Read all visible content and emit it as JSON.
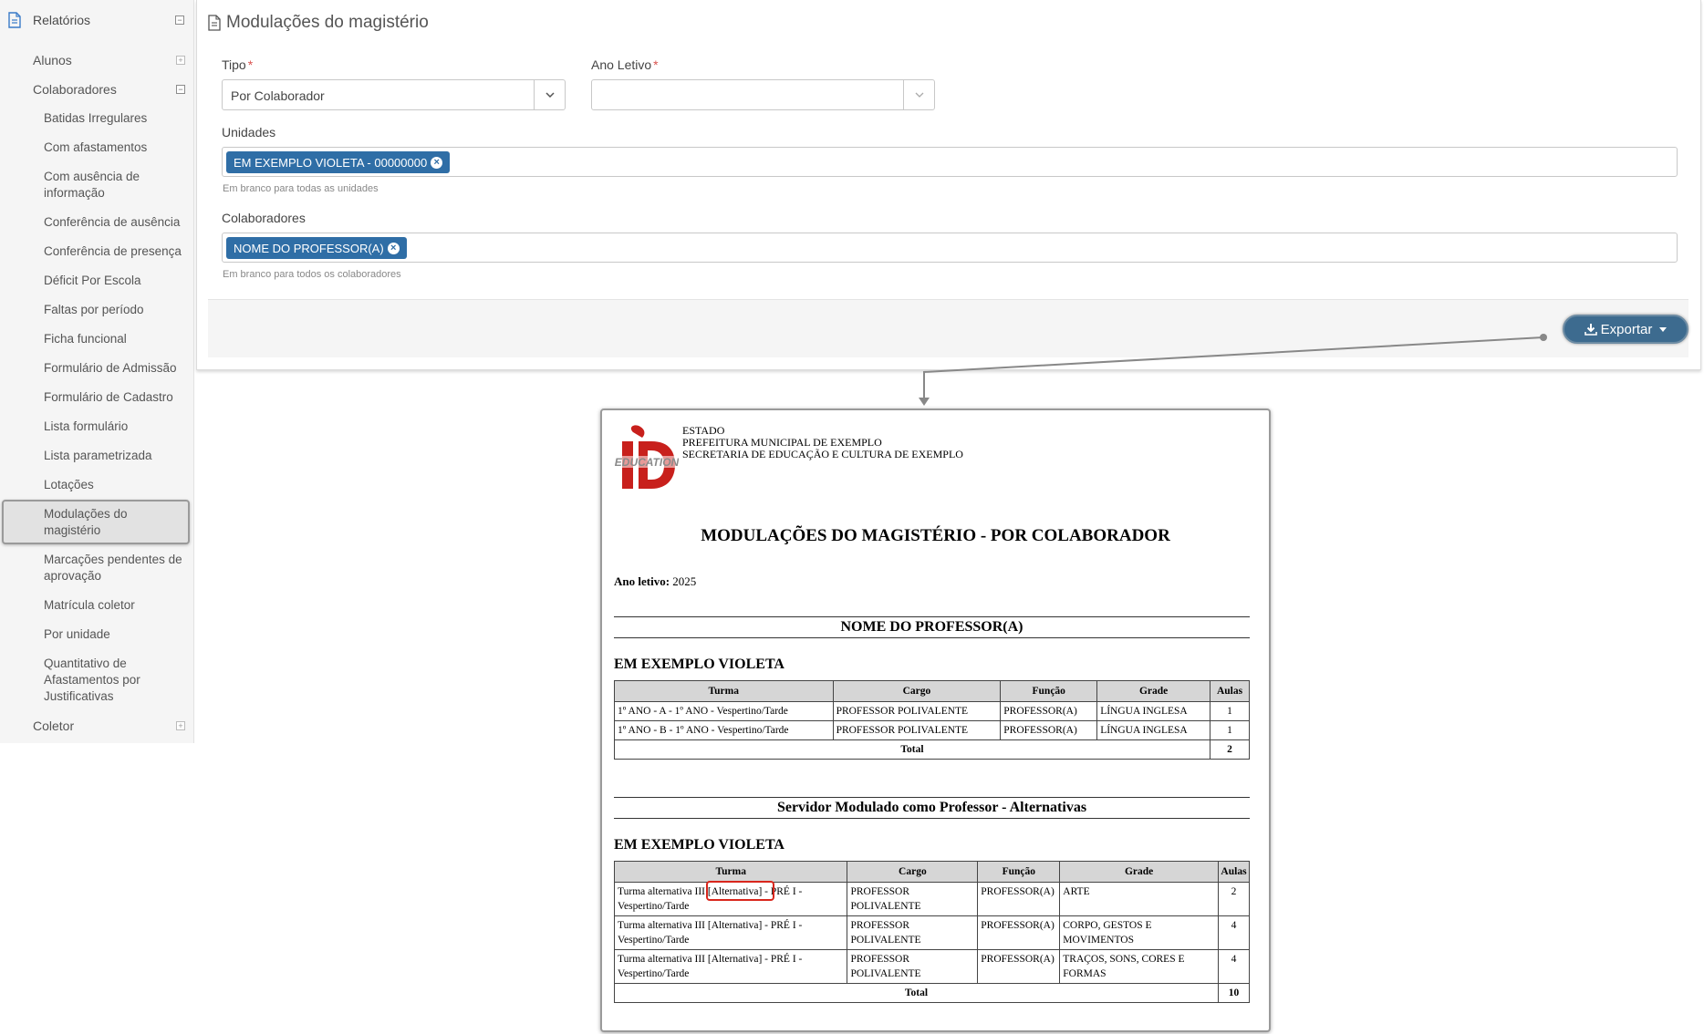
{
  "sidebar": {
    "root_label": "Relatórios",
    "alunos": "Alunos",
    "colaboradores": "Colaboradores",
    "items": [
      "Batidas Irregulares",
      "Com afastamentos",
      "Com ausência de informação",
      "Conferência de ausência",
      "Conferência de presença",
      "Déficit Por Escola",
      "Faltas por período",
      "Ficha funcional",
      "Formulário de Admissão",
      "Formulário de Cadastro",
      "Lista formulário",
      "Lista parametrizada",
      "Lotações",
      "Modulações do magistério",
      "Marcações pendentes de aprovação",
      "Matrícula coletor",
      "Por unidade",
      "Quantitativo de Afastamentos por Justificativas"
    ],
    "coletor": "Coletor",
    "active_item": "Modulações do magistério"
  },
  "form": {
    "title": "Modulações do magistério",
    "tipo_label": "Tipo",
    "tipo_value": "Por Colaborador",
    "ano_label": "Ano Letivo",
    "ano_value": "",
    "required_mark": "*",
    "unidades_label": "Unidades",
    "unidades_tag": "EM EXEMPLO VIOLETA - 00000000",
    "unidades_hint": "Em branco para todas as unidades",
    "colaboradores_label": "Colaboradores",
    "colaboradores_tag": "NOME DO PROFESSOR(A)",
    "colaboradores_hint": "Em branco para todos os colaboradores",
    "export_label": "Exportar"
  },
  "report": {
    "header_lines": [
      "ESTADO",
      "PREFEITURA MUNICIPAL DE EXEMPLO",
      "SECRETARIA DE EDUCAÇÃO E CULTURA DE EXEMPLO"
    ],
    "logo_text": "EDUCATION",
    "title": "MODULAÇÕES DO MAGISTÉRIO - POR COLABORADOR",
    "year_label": "Ano letivo:",
    "year_value": "2025",
    "teacher": "NOME DO PROFESSOR(A)",
    "school1": "EM EXEMPLO VIOLETA",
    "headers1": [
      "Turma",
      "Cargo",
      "Função",
      "Grade",
      "Aulas"
    ],
    "rows1": [
      [
        "1º ANO - A - 1º ANO - Vespertino/Tarde",
        "PROFESSOR POLIVALENTE",
        "PROFESSOR(A)",
        "LÍNGUA INGLESA",
        "1"
      ],
      [
        "1º ANO - B - 1º ANO - Vespertino/Tarde",
        "PROFESSOR POLIVALENTE",
        "PROFESSOR(A)",
        "LÍNGUA INGLESA",
        "1"
      ]
    ],
    "total_label": "Total",
    "total1": "2",
    "section2": "Servidor Modulado como Professor - Alternativas",
    "school2": "EM EXEMPLO VIOLETA",
    "rows2": [
      [
        "Turma alternativa III [Alternativa] - PRÉ I - Vespertino/Tarde",
        "PROFESSOR POLIVALENTE",
        "PROFESSOR(A)",
        "ARTE",
        "2"
      ],
      [
        "Turma alternativa III [Alternativa] - PRÉ I - Vespertino/Tarde",
        "PROFESSOR POLIVALENTE",
        "PROFESSOR(A)",
        "CORPO, GESTOS E MOVIMENTOS",
        "4"
      ],
      [
        "Turma alternativa III [Alternativa] - PRÉ I - Vespertino/Tarde",
        "PROFESSOR POLIVALENTE",
        "PROFESSOR(A)",
        "TRAÇOS, SONS, CORES E FORMAS",
        "4"
      ]
    ],
    "total2": "10"
  },
  "colors": {
    "tag_blue": "#2f6ea6",
    "export_button": "#3d6b8f",
    "required": "#d9534f",
    "highlight": "#d9261c",
    "logo_red": "#c8201c"
  }
}
